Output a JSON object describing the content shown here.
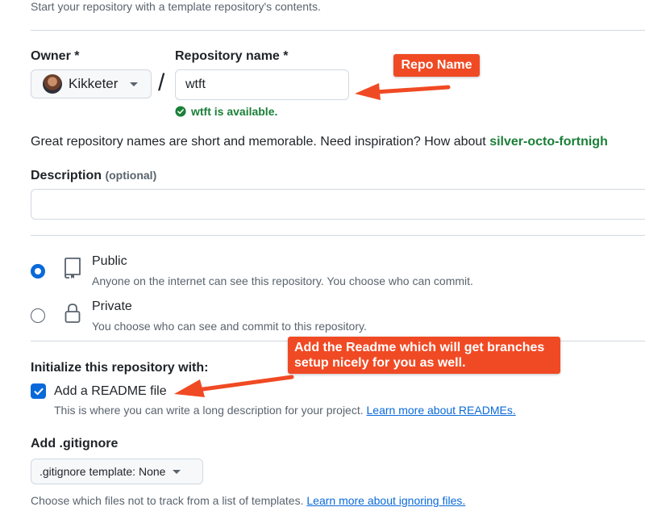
{
  "header": {
    "subtitle": "Start your repository with a template repository's contents."
  },
  "owner": {
    "label": "Owner *",
    "name": "Kikketer"
  },
  "separator": "/",
  "repo": {
    "label": "Repository name *",
    "value": "wtft",
    "availability": "wtft is available."
  },
  "hint": {
    "text": "Great repository names are short and memorable. Need inspiration? How about ",
    "suggestion": "silver-octo-fortnigh"
  },
  "description": {
    "label": "Description",
    "optional": "(optional)",
    "value": ""
  },
  "visibility": {
    "public_title": "Public",
    "public_desc": "Anyone on the internet can see this repository. You choose who can commit.",
    "private_title": "Private",
    "private_desc": "You choose who can see and commit to this repository.",
    "selected": "public"
  },
  "init": {
    "heading": "Initialize this repository with:",
    "readme_label": "Add a README file",
    "readme_checked": true,
    "readme_desc": "This is where you can write a long description for your project. ",
    "readme_link": "Learn more about READMEs."
  },
  "gitignore": {
    "heading": "Add .gitignore",
    "button": ".gitignore template: None",
    "desc": "Choose which files not to track from a list of templates. ",
    "link": "Learn more about ignoring files."
  },
  "annotations": {
    "repo_name": "Repo Name",
    "readme_line1": "Add the Readme which will get branches",
    "readme_line2": "setup nicely for you as well."
  },
  "colors": {
    "accent": "#0969da",
    "success": "#1a7f37",
    "callout": "#f04a24"
  }
}
